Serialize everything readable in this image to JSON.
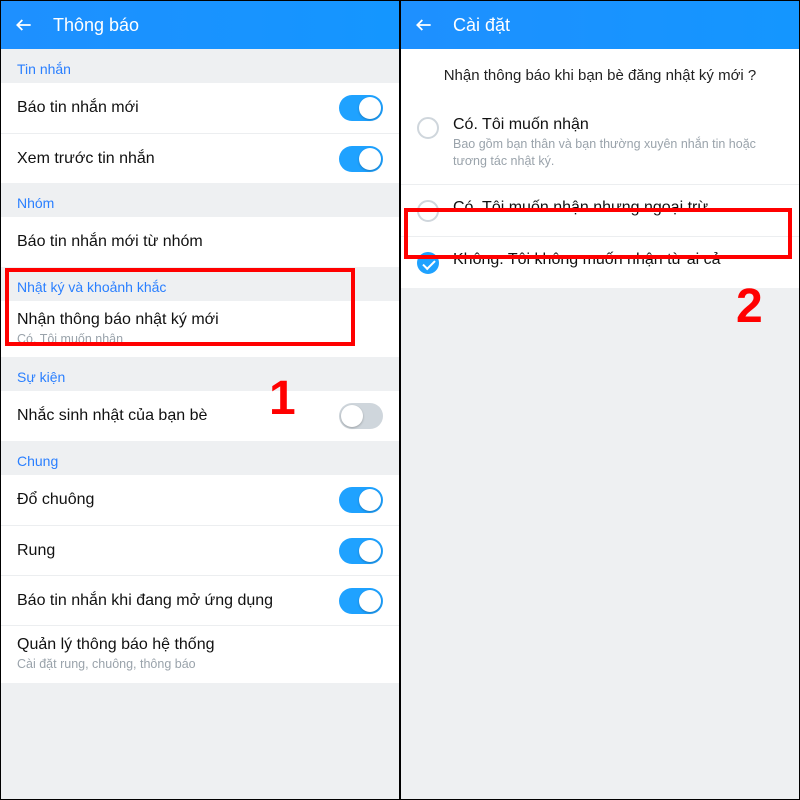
{
  "colors": {
    "accent": "#1fa2ff",
    "highlight": "#ff0000"
  },
  "left": {
    "title": "Thông báo",
    "sections": [
      {
        "header": "Tin nhắn",
        "rows": [
          {
            "label": "Báo tin nhắn mới",
            "toggle": "on"
          },
          {
            "label": "Xem trước tin nhắn",
            "toggle": "on"
          }
        ]
      },
      {
        "header": "Nhóm",
        "rows": [
          {
            "label": "Báo tin nhắn mới từ nhóm"
          }
        ]
      },
      {
        "header": "Nhật ký và khoảnh khắc",
        "rows": [
          {
            "label": "Nhận thông báo nhật ký mới",
            "sub": "Có. Tôi muốn nhận"
          }
        ]
      },
      {
        "header": "Sự kiện",
        "rows": [
          {
            "label": "Nhắc sinh nhật của bạn bè",
            "toggle": "off"
          }
        ]
      },
      {
        "header": "Chung",
        "rows": [
          {
            "label": "Đổ chuông",
            "toggle": "on"
          },
          {
            "label": "Rung",
            "toggle": "on"
          },
          {
            "label": "Báo tin nhắn khi đang mở ứng dụng",
            "toggle": "on"
          },
          {
            "label": "Quản lý thông báo hệ thống",
            "sub": "Cài đặt rung, chuông, thông báo"
          }
        ]
      }
    ],
    "stepNumber": "1"
  },
  "right": {
    "title": "Cài đặt",
    "question": "Nhận thông báo khi bạn bè đăng nhật ký mới ?",
    "options": [
      {
        "label": "Có. Tôi muốn nhận",
        "sub": "Bao gồm bạn thân và bạn thường xuyên nhắn tin hoặc tương tác nhật ký.",
        "checked": false
      },
      {
        "label": "Có. Tôi muốn nhận nhưng ngoại trừ",
        "checked": false
      },
      {
        "label": "Không. Tôi không muốn nhận từ ai cả",
        "checked": true
      }
    ],
    "stepNumber": "2"
  }
}
